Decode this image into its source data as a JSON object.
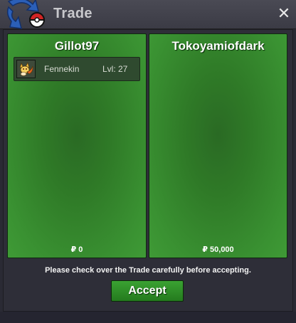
{
  "window": {
    "title": "Trade",
    "logo_icon": "pokeball-swap-icon",
    "close_icon": "close-icon",
    "close_glyph": "✕"
  },
  "left_panel": {
    "player_name": "Gillot97",
    "slots": [
      {
        "pokemon_icon": "fennekin-icon",
        "name": "Fennekin",
        "level": "Lvl: 27"
      }
    ],
    "money": "₽ 0"
  },
  "right_panel": {
    "player_name": "Tokoyamiofdark",
    "slots": [],
    "money": "₽ 50,000"
  },
  "message": "Please check over the Trade carefully before accepting.",
  "accept_label": "Accept",
  "colors": {
    "panel_green": "#3a9232",
    "button_green": "#2f8a28",
    "titlebar": "#444450"
  }
}
